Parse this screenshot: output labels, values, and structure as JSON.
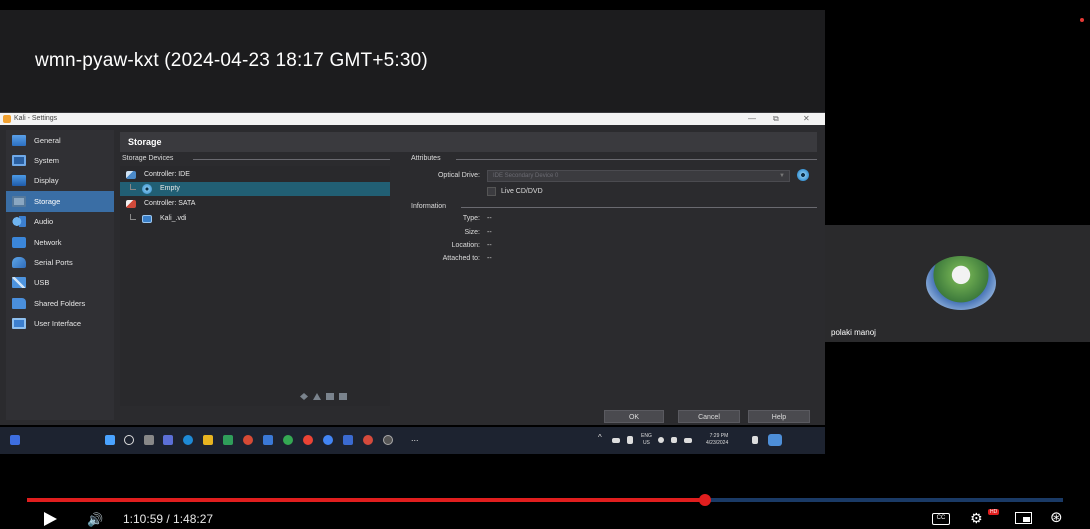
{
  "meeting": {
    "title": "wmn-pyaw-kxt (2024-04-23 18:17 GMT+5:30)"
  },
  "vbox": {
    "window_title": "Kali - Settings",
    "sidebar": [
      {
        "label": "General",
        "icon": "general-icon"
      },
      {
        "label": "System",
        "icon": "system-icon"
      },
      {
        "label": "Display",
        "icon": "display-icon"
      },
      {
        "label": "Storage",
        "icon": "storage-icon"
      },
      {
        "label": "Audio",
        "icon": "audio-icon"
      },
      {
        "label": "Network",
        "icon": "network-icon"
      },
      {
        "label": "Serial Ports",
        "icon": "serial-ports-icon"
      },
      {
        "label": "USB",
        "icon": "usb-icon"
      },
      {
        "label": "Shared Folders",
        "icon": "shared-folders-icon"
      },
      {
        "label": "User Interface",
        "icon": "user-interface-icon"
      }
    ],
    "active_section": "Storage",
    "page_title": "Storage",
    "storage_devices_label": "Storage Devices",
    "tree": {
      "ide_controller": "Controller: IDE",
      "ide_child": "Empty",
      "sata_controller": "Controller: SATA",
      "sata_child": "Kali_.vdi"
    },
    "attributes_label": "Attributes",
    "optical_drive_label": "Optical Drive:",
    "optical_drive_value": "IDE Secondary Device 0",
    "live_cd_label": "Live CD/DVD",
    "information_label": "Information",
    "info": {
      "type_label": "Type:",
      "type_value": "--",
      "size_label": "Size:",
      "size_value": "--",
      "location_label": "Location:",
      "location_value": "--",
      "attached_label": "Attached to:",
      "attached_value": "--"
    },
    "buttons": {
      "ok": "OK",
      "cancel": "Cancel",
      "help": "Help"
    }
  },
  "taskbar": {
    "lang_top": "ENG",
    "lang_bottom": "US",
    "time": "7:29 PM",
    "date": "4/23/2024",
    "overflow": "..."
  },
  "participant": {
    "name": "polaki manoj"
  },
  "player": {
    "current_time": "1:10:59",
    "duration": "1:48:27",
    "time_display": "1:10:59 / 1:48:27",
    "progress_fraction": 0.6547,
    "cc_label": "CC",
    "hd_label": "HD",
    "accent": "#e01e1e"
  }
}
